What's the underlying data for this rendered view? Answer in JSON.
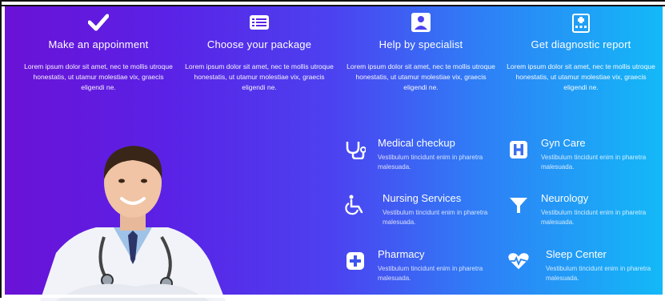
{
  "steps": [
    {
      "icon": "checkmark-icon",
      "title": "Make an appoinment",
      "desc": "Lorem ipsum dolor sit amet, nec te mollis utroque honestatis, ut utamur molestiae vix, graecis eligendi ne."
    },
    {
      "icon": "list-card-icon",
      "title": "Choose your package",
      "desc": "Lorem ipsum dolor sit amet, nec te mollis utroque honestatis, ut utamur molestiae vix, graecis eligendi ne."
    },
    {
      "icon": "specialist-icon",
      "title": "Help by specialist",
      "desc": "Lorem ipsum dolor sit amet, nec te mollis utroque honestatis, ut utamur molestiae vix, graecis eligendi ne."
    },
    {
      "icon": "hospital-building-icon",
      "title": "Get diagnostic report",
      "desc": "Lorem ipsum dolor sit amet, nec te mollis utroque honestatis, ut utamur molestiae vix, graecis eligendi ne."
    }
  ],
  "services": [
    {
      "icon": "stethoscope-icon",
      "name": "Medical checkup",
      "sub": "Vestibulum tincidunt enim in pharetra malesuada."
    },
    {
      "icon": "hospital-sign-icon",
      "name": "Gyn Care",
      "sub": "Vestibulum tincidunt enim in pharetra malesuada."
    },
    {
      "icon": "wheelchair-icon",
      "name": "Nursing Services",
      "sub": "Vestibulum tincidunt enim in pharetra malesuada."
    },
    {
      "icon": "funnel-icon",
      "name": "Neurology",
      "sub": "Vestibulum tincidunt enim in pharetra malesuada."
    },
    {
      "icon": "plus-box-icon",
      "name": "Pharmacy",
      "sub": "Vestibulum tincidunt enim in pharetra malesuada."
    },
    {
      "icon": "heart-pulse-icon",
      "name": "Sleep Center",
      "sub": "Vestibulum tincidunt enim in pharetra malesuada."
    }
  ]
}
